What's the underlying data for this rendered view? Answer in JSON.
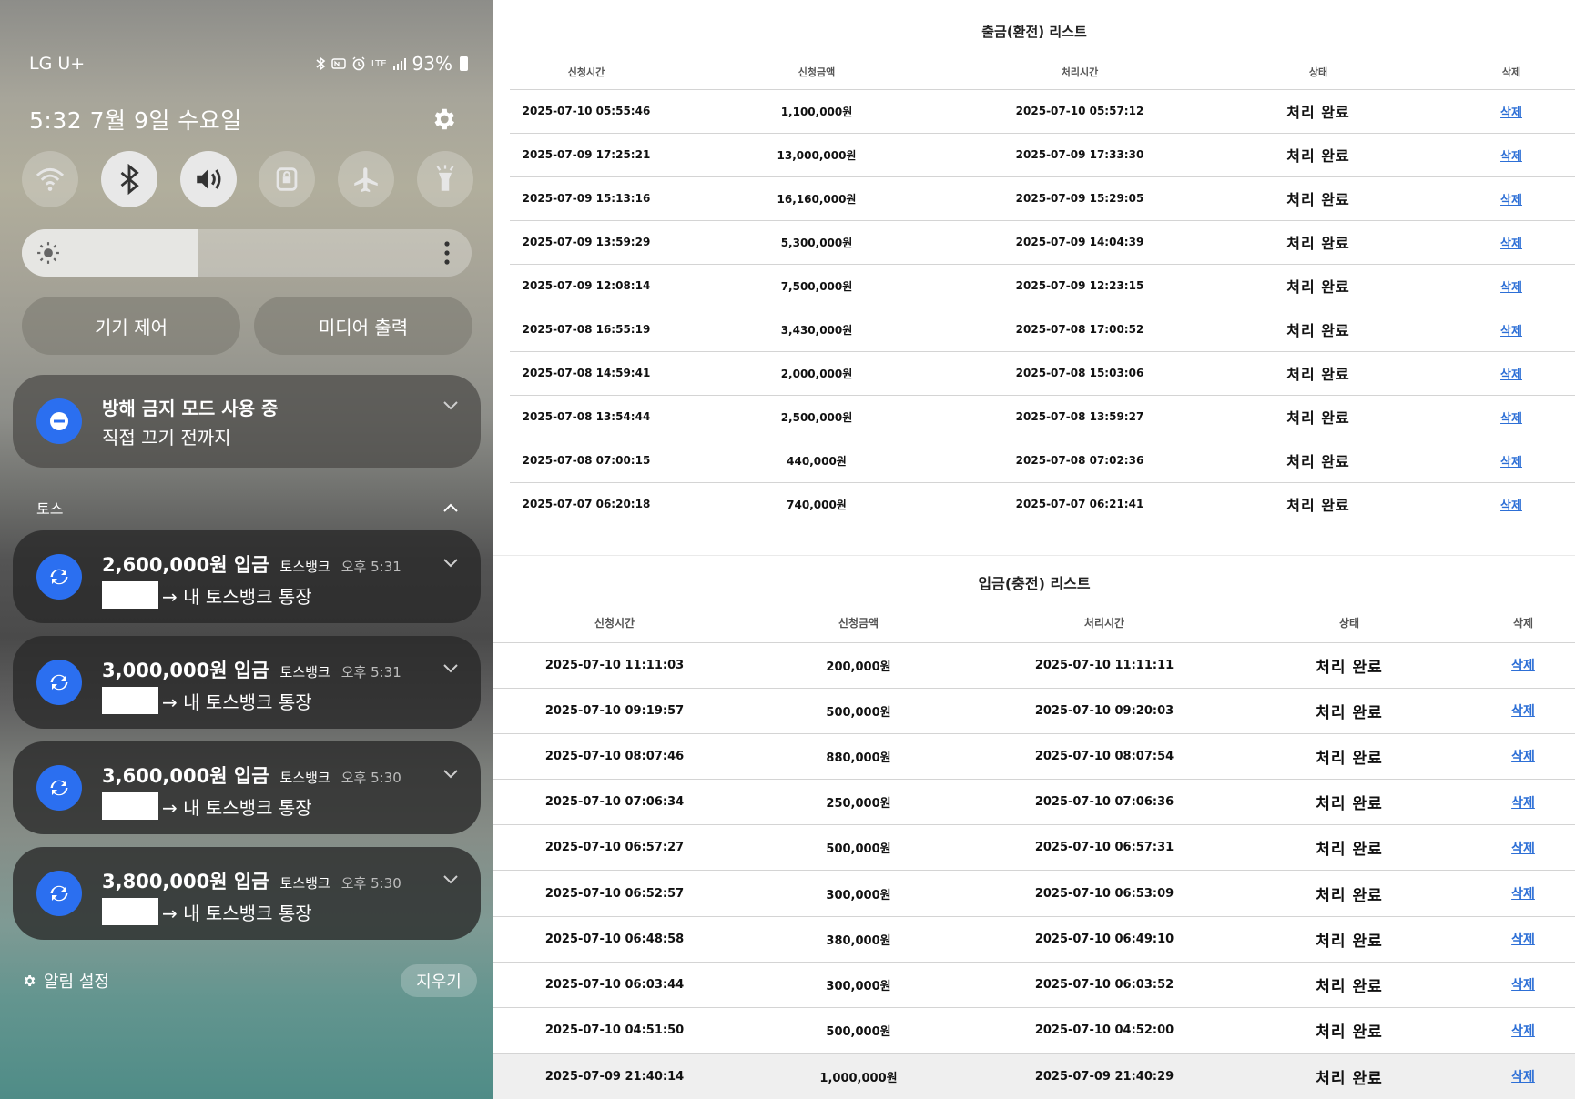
{
  "phone": {
    "status_bar": {
      "carrier": "LG U+",
      "battery": "93%",
      "network": "LTE"
    },
    "date": "5:32  7월 9일 수요일",
    "quick_settings": [
      {
        "name": "wifi",
        "active": false
      },
      {
        "name": "bluetooth",
        "active": true
      },
      {
        "name": "sound",
        "active": true
      },
      {
        "name": "screen-lock",
        "active": false
      },
      {
        "name": "airplane",
        "active": false
      },
      {
        "name": "flashlight",
        "active": false
      }
    ],
    "brightness_percent": 39,
    "device_control_label": "기기 제어",
    "media_output_label": "미디어 출력",
    "dnd": {
      "title": "방해 금지 모드 사용 중",
      "subtitle": "직접 끄기 전까지"
    },
    "notification_group": "토스",
    "notifications": [
      {
        "amount": "2,600,000원 입금",
        "app": "토스뱅크",
        "time": "오후 5:31",
        "body": "→ 내 토스뱅크 통장"
      },
      {
        "amount": "3,000,000원 입금",
        "app": "토스뱅크",
        "time": "오후 5:31",
        "body": "→ 내 토스뱅크 통장"
      },
      {
        "amount": "3,600,000원 입금",
        "app": "토스뱅크",
        "time": "오후 5:30",
        "body": "→ 내 토스뱅크 통장"
      },
      {
        "amount": "3,800,000원 입금",
        "app": "토스뱅크",
        "time": "오후 5:30",
        "body": "→ 내 토스뱅크 통장"
      }
    ],
    "notification_settings_label": "알림 설정",
    "clear_label": "지우기"
  },
  "withdraw": {
    "title": "출금(환전) 리스트",
    "headers": [
      "신청시간",
      "신청금액",
      "처리시간",
      "상태",
      "삭제"
    ],
    "rows": [
      [
        "2025-07-10 05:55:46",
        "1,100,000원",
        "2025-07-10 05:57:12",
        "처리 완료",
        "삭제"
      ],
      [
        "2025-07-09 17:25:21",
        "13,000,000원",
        "2025-07-09 17:33:30",
        "처리 완료",
        "삭제"
      ],
      [
        "2025-07-09 15:13:16",
        "16,160,000원",
        "2025-07-09 15:29:05",
        "처리 완료",
        "삭제"
      ],
      [
        "2025-07-09 13:59:29",
        "5,300,000원",
        "2025-07-09 14:04:39",
        "처리 완료",
        "삭제"
      ],
      [
        "2025-07-09 12:08:14",
        "7,500,000원",
        "2025-07-09 12:23:15",
        "처리 완료",
        "삭제"
      ],
      [
        "2025-07-08 16:55:19",
        "3,430,000원",
        "2025-07-08 17:00:52",
        "처리 완료",
        "삭제"
      ],
      [
        "2025-07-08 14:59:41",
        "2,000,000원",
        "2025-07-08 15:03:06",
        "처리 완료",
        "삭제"
      ],
      [
        "2025-07-08 13:54:44",
        "2,500,000원",
        "2025-07-08 13:59:27",
        "처리 완료",
        "삭제"
      ],
      [
        "2025-07-08 07:00:15",
        "440,000원",
        "2025-07-08 07:02:36",
        "처리 완료",
        "삭제"
      ],
      [
        "2025-07-07 06:20:18",
        "740,000원",
        "2025-07-07 06:21:41",
        "처리 완료",
        "삭제"
      ]
    ]
  },
  "deposit": {
    "title": "입금(충전) 리스트",
    "headers": [
      "신청시간",
      "신청금액",
      "처리시간",
      "상태",
      "삭제"
    ],
    "rows": [
      [
        "2025-07-10 11:11:03",
        "200,000원",
        "2025-07-10 11:11:11",
        "처리 완료",
        "삭제"
      ],
      [
        "2025-07-10 09:19:57",
        "500,000원",
        "2025-07-10 09:20:03",
        "처리 완료",
        "삭제"
      ],
      [
        "2025-07-10 08:07:46",
        "880,000원",
        "2025-07-10 08:07:54",
        "처리 완료",
        "삭제"
      ],
      [
        "2025-07-10 07:06:34",
        "250,000원",
        "2025-07-10 07:06:36",
        "처리 완료",
        "삭제"
      ],
      [
        "2025-07-10 06:57:27",
        "500,000원",
        "2025-07-10 06:57:31",
        "처리 완료",
        "삭제"
      ],
      [
        "2025-07-10 06:52:57",
        "300,000원",
        "2025-07-10 06:53:09",
        "처리 완료",
        "삭제"
      ],
      [
        "2025-07-10 06:48:58",
        "380,000원",
        "2025-07-10 06:49:10",
        "처리 완료",
        "삭제"
      ],
      [
        "2025-07-10 06:03:44",
        "300,000원",
        "2025-07-10 06:03:52",
        "처리 완료",
        "삭제"
      ],
      [
        "2025-07-10 04:51:50",
        "500,000원",
        "2025-07-10 04:52:00",
        "처리 완료",
        "삭제"
      ],
      [
        "2025-07-09 21:40:14",
        "1,000,000원",
        "2025-07-09 21:40:29",
        "처리 완료",
        "삭제"
      ]
    ]
  },
  "colors": {
    "link": "#2d6fd6",
    "toss_blue": "#2b6ff0"
  }
}
